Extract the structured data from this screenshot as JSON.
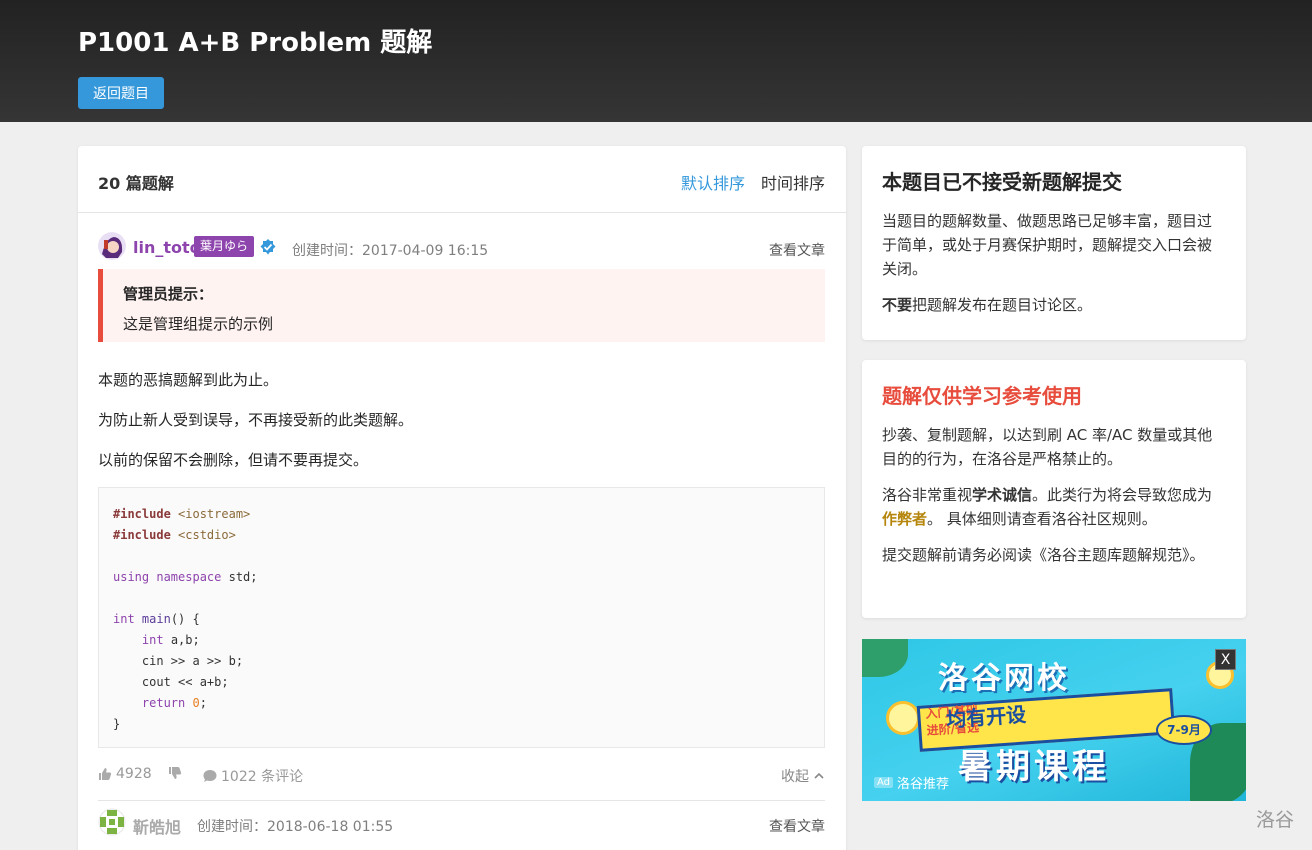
{
  "header": {
    "title": "P1001 A+B Problem 题解",
    "back_label": "返回题目"
  },
  "main": {
    "count": "20 篇题解",
    "sort_default": "默认排序",
    "sort_time": "时间排序"
  },
  "solutions": [
    {
      "username": "lin_toto",
      "badge": "葉月ゆら",
      "created": "创建时间：2017-04-09 16:15",
      "view": "查看文章",
      "admin_title": "管理员提示：",
      "admin_text": "这是管理组提示的示例",
      "paragraphs": [
        "本题的恶搞题解到此为止。",
        "为防止新人受到误导，不再接受新的此类题解。",
        "以前的保留不会删除，但请不要再提交。"
      ],
      "likes": "4928",
      "comments": "1022 条评论",
      "collapse": "收起",
      "name_color": "#8e44ad"
    },
    {
      "username": "靳皓旭",
      "created": "创建时间：2018-06-18 01:55",
      "view": "查看文章"
    }
  ],
  "sidebar": {
    "card1": {
      "title": "本题目已不接受新题解提交",
      "p1": "当题目的题解数量、做题思路已足够丰富，题目过于简单，或处于月赛保护期时，题解提交入口会被关闭。",
      "p2_bold": "不要",
      "p2_rest": "把题解发布在题目讨论区。"
    },
    "card2": {
      "title": "题解仅供学习参考使用",
      "p1": "抄袭、复制题解，以达到刷 AC 率/AC 数量或其他目的的行为，在洛谷是严格禁止的。",
      "p2_a": "洛谷非常重视",
      "p2_bold": "学术诚信",
      "p2_b": "。此类行为将会导致您成为",
      "p2_gold": "作弊者",
      "p2_c": "。 具体细则请查看洛谷社区规则。",
      "p3": "提交题解前请务必阅读《洛谷主题库题解规范》。"
    }
  },
  "ad": {
    "brand": "洛谷网校",
    "tag1": "入门/基础",
    "tag2": "进阶/省选",
    "ribbon": "均有开设",
    "month": "7-9月",
    "big": "暑期课程",
    "mark": "Ad",
    "label": "洛谷推荐",
    "close": "X"
  },
  "watermark": "洛谷"
}
